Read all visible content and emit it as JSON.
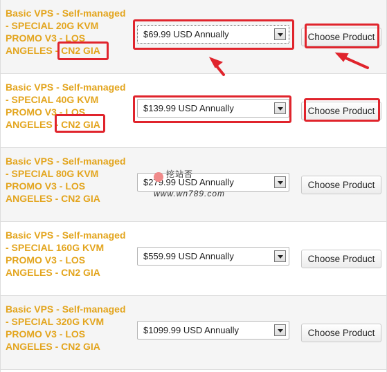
{
  "products": [
    {
      "name_lines": [
        "Basic VPS - Self-managed",
        "- SPECIAL 20G KVM",
        "PROMO V3 - LOS",
        "ANGELES - "
      ],
      "tag": "CN2 GIA",
      "price": "$69.99 USD Annually",
      "button": "Choose Product"
    },
    {
      "name_lines": [
        "Basic VPS - Self-managed",
        "- SPECIAL 40G KVM",
        "PROMO V3 - LOS",
        "ANGELES - "
      ],
      "tag": "CN2 GIA",
      "price": "$139.99 USD Annually",
      "button": "Choose Product"
    },
    {
      "name_lines": [
        "Basic VPS - Self-managed",
        "- SPECIAL 80G KVM",
        "PROMO V3 - LOS",
        "ANGELES - "
      ],
      "tag": "CN2 GIA",
      "price": "$279.99 USD Annually",
      "button": "Choose Product"
    },
    {
      "name_lines": [
        "Basic VPS - Self-managed",
        "- SPECIAL 160G KVM",
        "PROMO V3 - LOS",
        "ANGELES - "
      ],
      "tag": "CN2 GIA",
      "price": "$559.99 USD Annually",
      "button": "Choose Product"
    },
    {
      "name_lines": [
        "Basic VPS - Self-managed",
        "- SPECIAL 320G KVM",
        "PROMO V3 - LOS",
        "ANGELES - "
      ],
      "tag": "CN2 GIA",
      "price": "$1099.99 USD Annually",
      "button": "Choose Product"
    }
  ],
  "watermark": {
    "line1": "挖站否",
    "line2": "www.wn789.com"
  },
  "colors": {
    "product_name": "#e3a51e",
    "highlight": "#e0242c",
    "row_alt": "#f5f5f5"
  }
}
